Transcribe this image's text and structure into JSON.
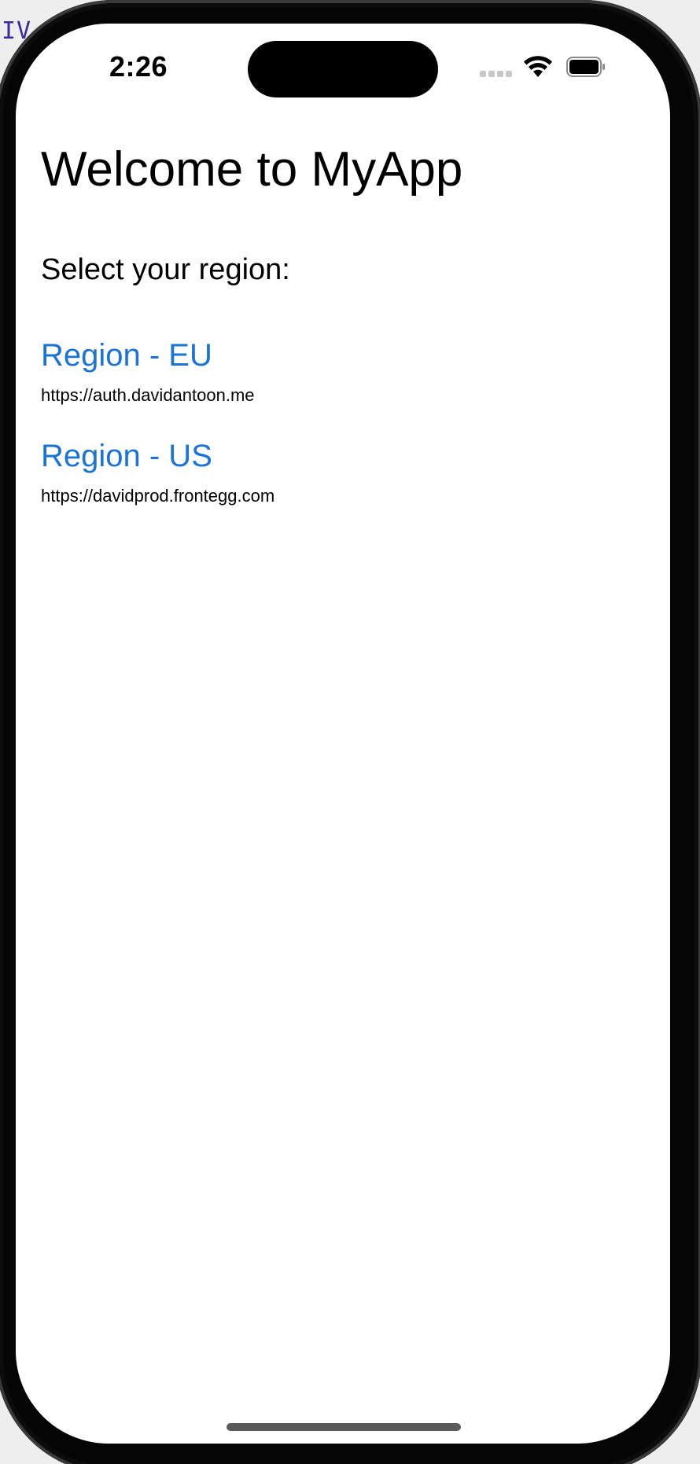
{
  "behind_window": {
    "text": "IV"
  },
  "status_bar": {
    "time": "2:26",
    "icons": [
      "cellular-signal-icon",
      "wifi-icon",
      "battery-icon"
    ]
  },
  "main": {
    "title": "Welcome to MyApp",
    "subtitle": "Select your region:",
    "regions": [
      {
        "label": "Region - EU",
        "url": "https://auth.davidantoon.me"
      },
      {
        "label": "Region - US",
        "url": "https://davidprod.frontegg.com"
      }
    ]
  },
  "colors": {
    "link": "#1a73d9",
    "text": "#000000",
    "background": "#ffffff"
  }
}
